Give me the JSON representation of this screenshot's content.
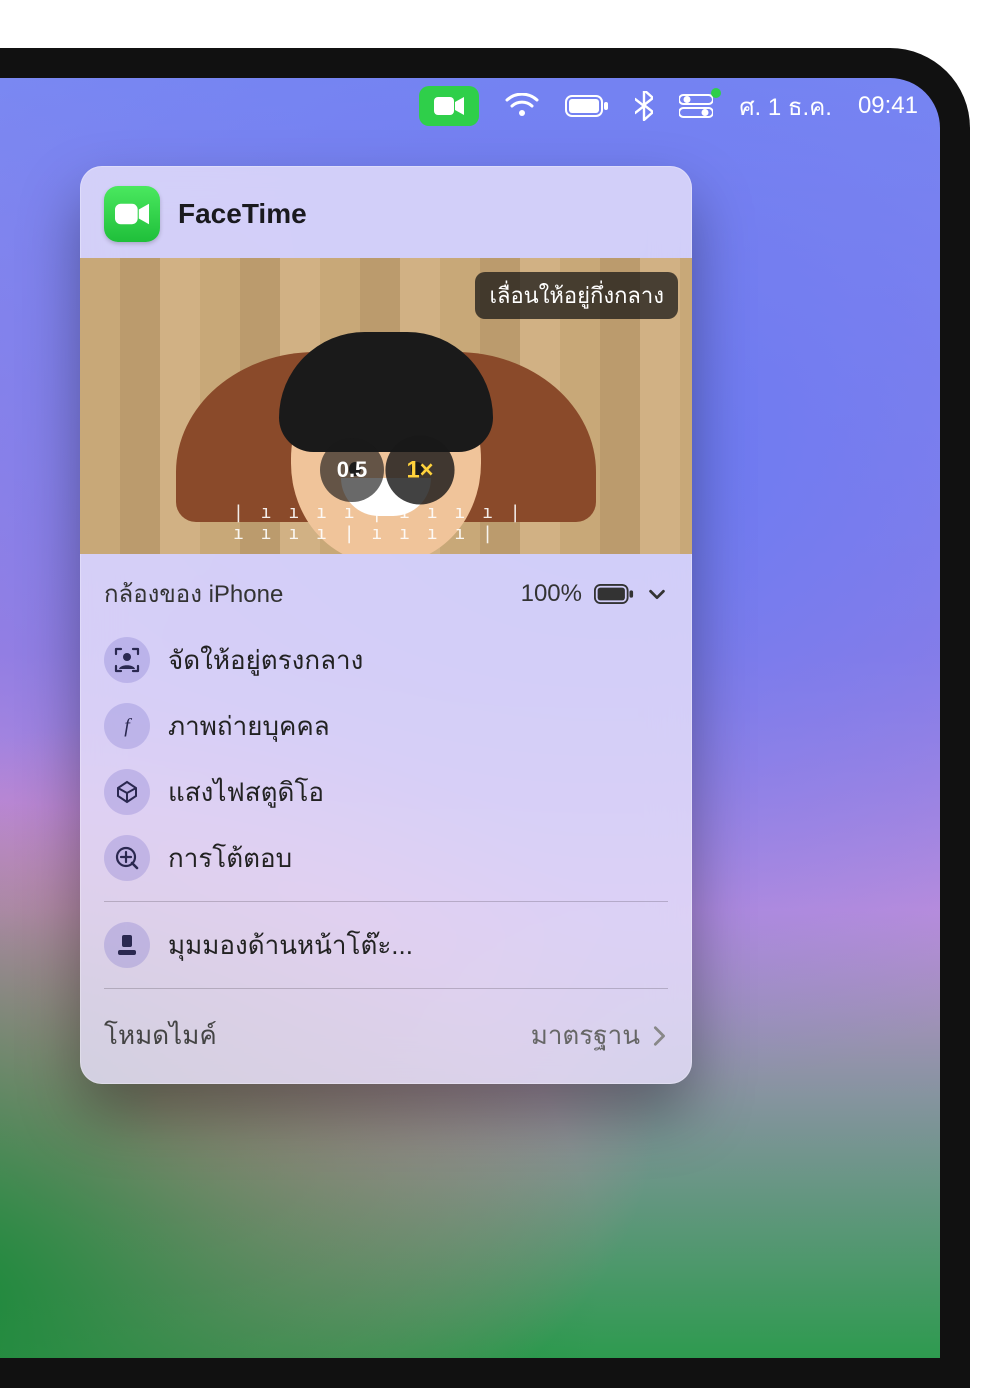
{
  "menubar": {
    "date": "ศ. 1 ธ.ค.",
    "time": "09:41"
  },
  "panel": {
    "app_name": "FaceTime",
    "preview": {
      "recenter_hint": "เลื่อนให้อยู่กึ่งกลาง",
      "zoom_options": [
        "0.5",
        "1×"
      ],
      "zoom_active_index": 1
    },
    "camera_source": {
      "label": "กล้องของ iPhone",
      "battery_percent": "100%"
    },
    "video_effects": [
      {
        "icon": "center-stage",
        "label": "จัดให้อยู่ตรงกลาง"
      },
      {
        "icon": "portrait",
        "label": "ภาพถ่ายบุคคล"
      },
      {
        "icon": "studio-light",
        "label": "แสงไฟสตูดิโอ"
      },
      {
        "icon": "reactions",
        "label": "การโต้ตอบ"
      }
    ],
    "desk_view_label": "มุมมองด้านหน้าโต๊ะ...",
    "mic_mode": {
      "label": "โหมดไมค์",
      "value": "มาตรฐาน"
    }
  }
}
